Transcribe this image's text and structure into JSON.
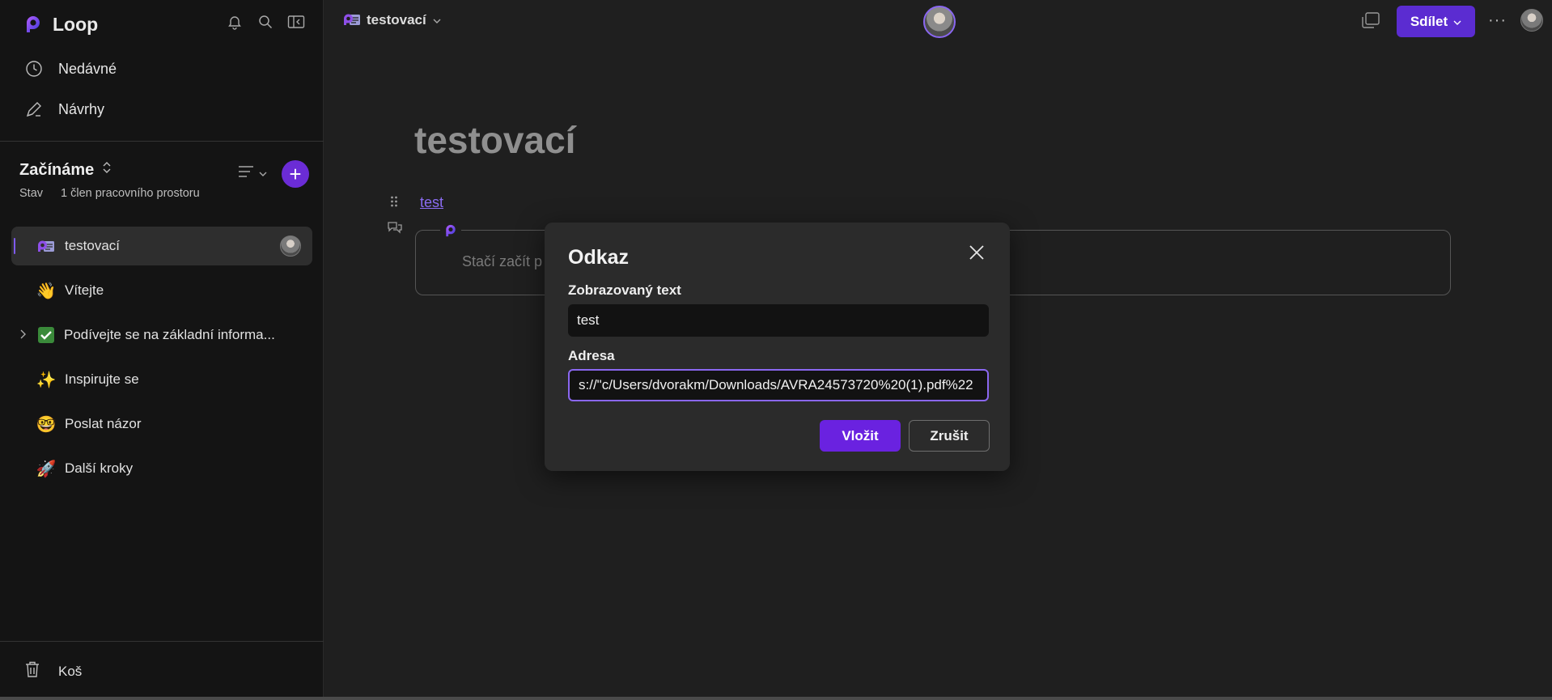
{
  "app": {
    "name": "Loop"
  },
  "sidebar": {
    "nav": [
      {
        "label": "Nedávné",
        "icon": "clock-icon"
      },
      {
        "label": "Návrhy",
        "icon": "pen-icon"
      }
    ],
    "workspace": {
      "title": "Začínáme",
      "status_label": "Stav",
      "members": "1 člen pracovního prostoru"
    },
    "pages": [
      {
        "label": "testovací",
        "icon": "loop-page-icon",
        "active": true
      },
      {
        "label": "Vítejte",
        "icon": "👋"
      },
      {
        "label": "Podívejte se na základní informa...",
        "icon": "✅",
        "expandable": true
      },
      {
        "label": "Inspirujte se",
        "icon": "✨"
      },
      {
        "label": "Poslat názor",
        "icon": "🤓"
      },
      {
        "label": "Další kroky",
        "icon": "🚀"
      }
    ],
    "trash_label": "Koš"
  },
  "topbar": {
    "breadcrumb": "testovací",
    "share_label": "Sdílet",
    "more_label": "···"
  },
  "document": {
    "title": "testovací",
    "link_text": "test",
    "component_placeholder": "Stačí začít p"
  },
  "dialog": {
    "title": "Odkaz",
    "display_text_label": "Zobrazovaný text",
    "display_text_value": "test",
    "address_label": "Adresa",
    "address_value": "s://\"c/Users/dvorakm/Downloads/AVRA24573720%20(1).pdf%22",
    "insert_label": "Vložit",
    "cancel_label": "Zrušit"
  },
  "colors": {
    "accent": "#6a22e0",
    "share": "#5b2cd1",
    "link": "#8b6cf2",
    "focus_ring": "#8a67f0"
  }
}
